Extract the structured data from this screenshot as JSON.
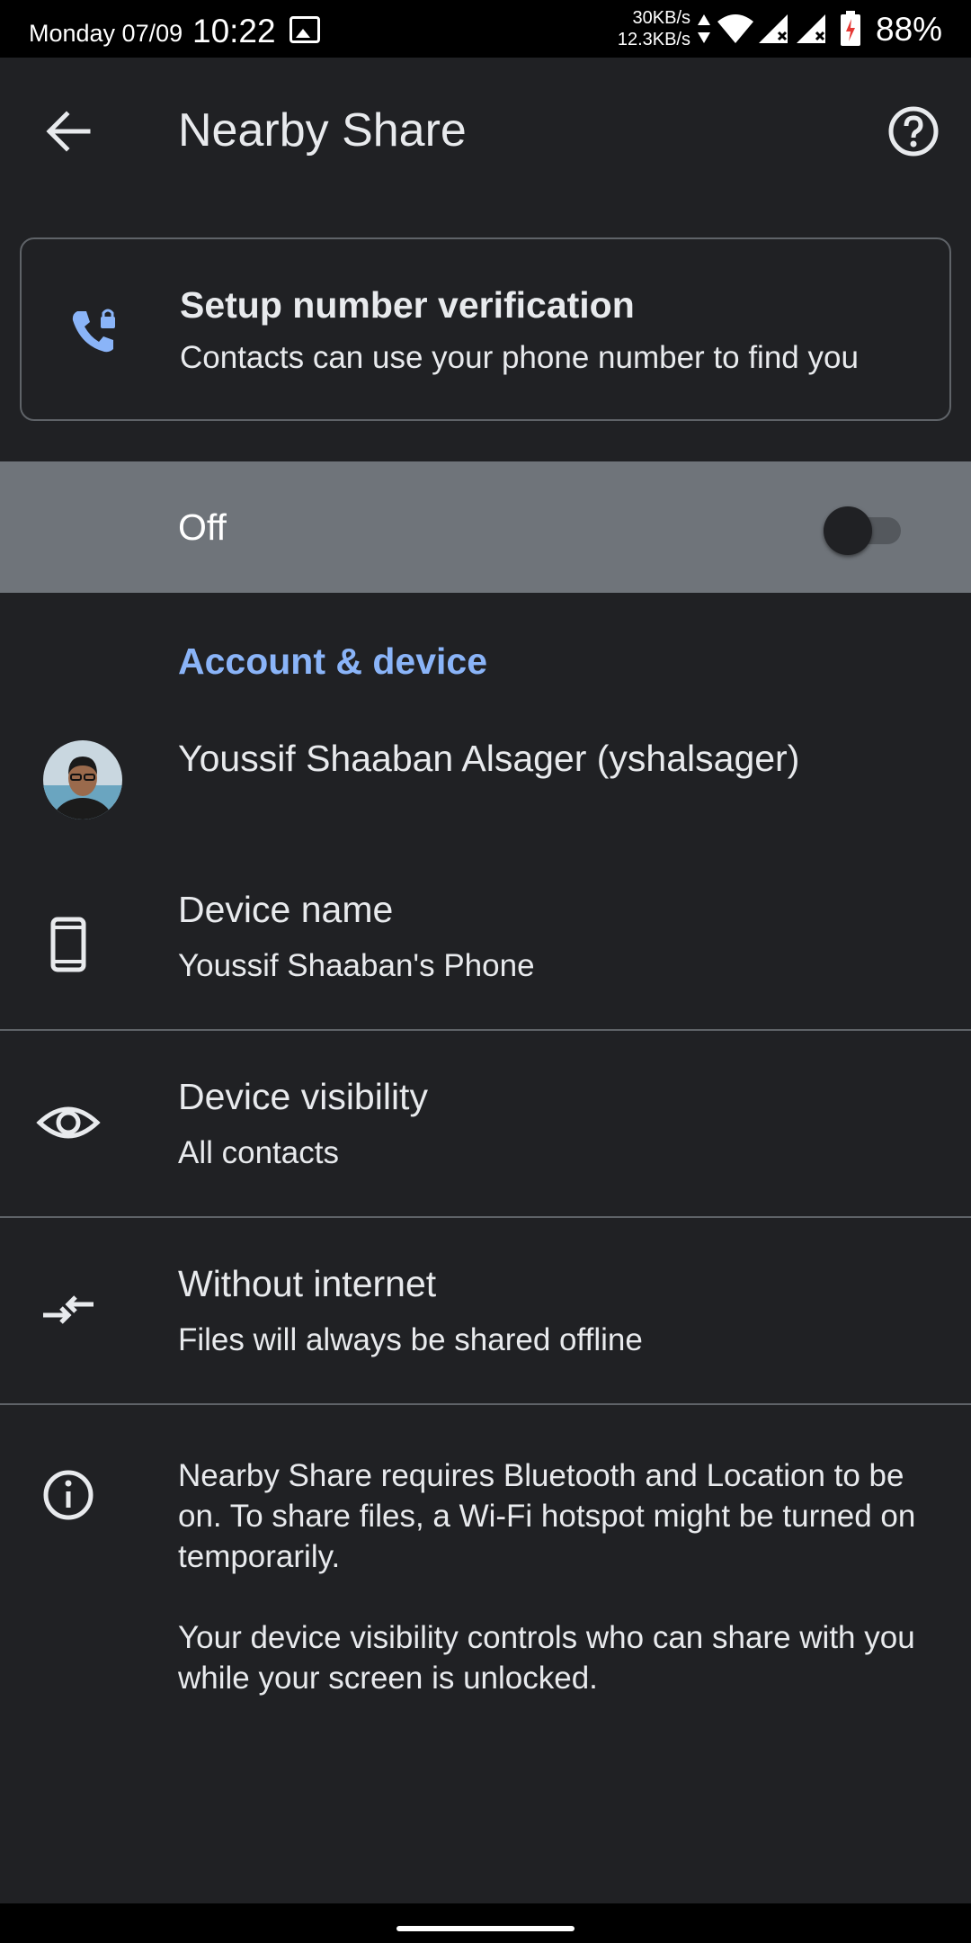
{
  "status_bar": {
    "date": "Monday 07/09",
    "time": "10:22",
    "speed_up": "30KB/s",
    "speed_down": "12.3KB/s",
    "battery": "88%",
    "icons": [
      "image-icon",
      "data-arrows-icon",
      "wifi-icon",
      "signal-icon",
      "signal-icon",
      "battery-icon"
    ]
  },
  "toolbar": {
    "title": "Nearby Share",
    "back_icon": "arrow-back-icon",
    "help_icon": "help-icon"
  },
  "verification_card": {
    "icon": "phone-lock-icon",
    "title": "Setup number verification",
    "subtitle": "Contacts can use your phone number to find you"
  },
  "main_toggle": {
    "label": "Off",
    "state": "off"
  },
  "section": {
    "title": "Account & device"
  },
  "account": {
    "name": "Youssif Shaaban Alsager (yshalsager)"
  },
  "settings": [
    {
      "icon": "phone-icon",
      "title": "Device name",
      "subtitle": "Youssif Shaaban's Phone"
    },
    {
      "icon": "eye-icon",
      "title": "Device visibility",
      "subtitle": "All contacts"
    },
    {
      "icon": "offline-arrows-icon",
      "title": "Without internet",
      "subtitle": "Files will always be shared offline"
    }
  ],
  "info": {
    "icon": "info-icon",
    "paragraph1": "Nearby Share requires Bluetooth and Location to be on. To share files, a Wi-Fi hotspot might be turned on temporarily.",
    "paragraph2": "Your device visibility controls who can share with you while your screen is unlocked."
  },
  "colors": {
    "background": "#202124",
    "accent": "#8ab4f8",
    "toggle_row": "#6f747a"
  }
}
